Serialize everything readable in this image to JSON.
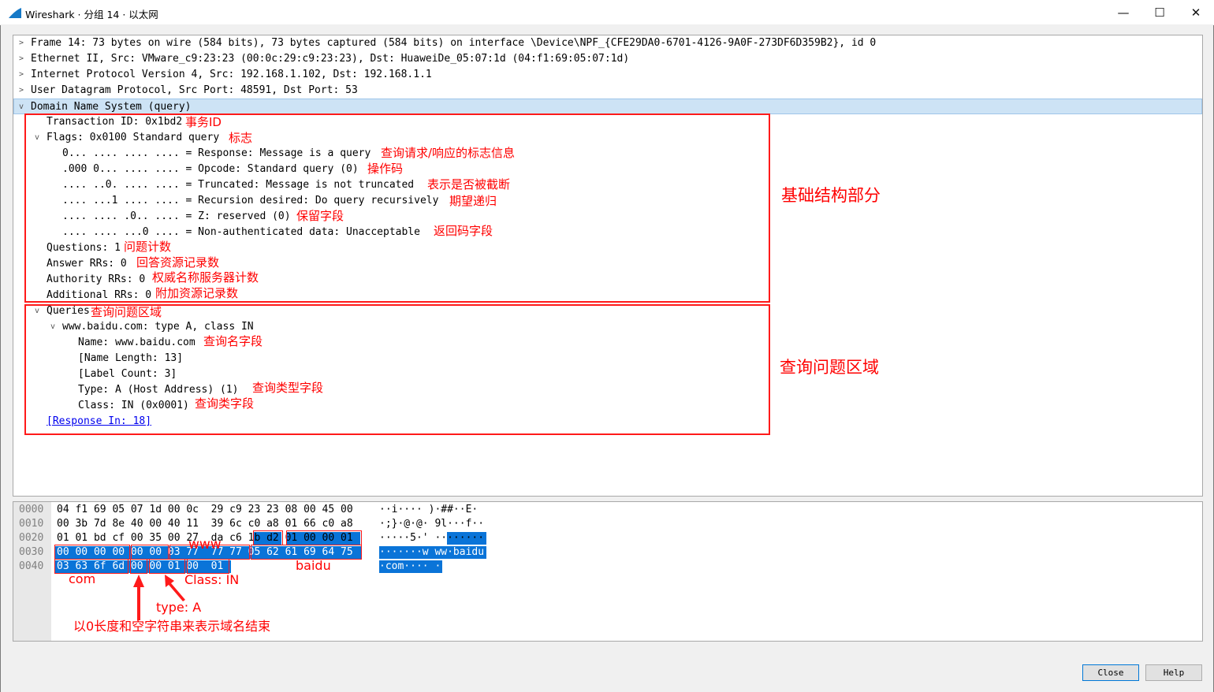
{
  "window": {
    "title": "Wireshark · 分组 14 · 以太网",
    "minimize": "—",
    "maximize": "☐",
    "close": "✕"
  },
  "tree": {
    "rows": [
      {
        "text": "Frame 14: 73 bytes on wire (584 bits), 73 bytes captured (584 bits) on interface \\Device\\NPF_{CFE29DA0-6701-4126-9A0F-273DF6D359B2}, id 0",
        "arrow": ">"
      },
      {
        "text": "Ethernet II, Src: VMware_c9:23:23 (00:0c:29:c9:23:23), Dst: HuaweiDe_05:07:1d (04:f1:69:05:07:1d)",
        "arrow": ">"
      },
      {
        "text": "Internet Protocol Version 4, Src: 192.168.1.102, Dst: 192.168.1.1",
        "arrow": ">"
      },
      {
        "text": "User Datagram Protocol, Src Port: 48591, Dst Port: 53",
        "arrow": ">"
      },
      {
        "text": "Domain Name System (query)",
        "arrow": "v"
      },
      {
        "text": "Transaction ID: 0x1bd2",
        "arrow": ""
      },
      {
        "text": "Flags: 0x0100 Standard query",
        "arrow": "v"
      },
      {
        "text": "0... .... .... .... = Response: Message is a query",
        "arrow": ""
      },
      {
        "text": ".000 0... .... .... = Opcode: Standard query (0)",
        "arrow": ""
      },
      {
        "text": ".... ..0. .... .... = Truncated: Message is not truncated",
        "arrow": ""
      },
      {
        "text": ".... ...1 .... .... = Recursion desired: Do query recursively",
        "arrow": ""
      },
      {
        "text": ".... .... .0.. .... = Z: reserved (0)",
        "arrow": ""
      },
      {
        "text": ".... .... ...0 .... = Non-authenticated data: Unacceptable",
        "arrow": ""
      },
      {
        "text": "Questions: 1",
        "arrow": ""
      },
      {
        "text": "Answer RRs: 0",
        "arrow": ""
      },
      {
        "text": "Authority RRs: 0",
        "arrow": ""
      },
      {
        "text": "Additional RRs: 0",
        "arrow": ""
      },
      {
        "text": "Queries",
        "arrow": "v"
      },
      {
        "text": "www.baidu.com: type A, class IN",
        "arrow": "v"
      },
      {
        "text": "Name: www.baidu.com",
        "arrow": ""
      },
      {
        "text": "[Name Length: 13]",
        "arrow": ""
      },
      {
        "text": "[Label Count: 3]",
        "arrow": ""
      },
      {
        "text": "Type: A (Host Address) (1)",
        "arrow": ""
      },
      {
        "text": "Class: IN (0x0001)",
        "arrow": ""
      },
      {
        "text": "[Response In: 18]",
        "arrow": ""
      }
    ]
  },
  "annotations": {
    "transaction_id": "事务ID",
    "flags": "标志",
    "response": "查询请求/响应的标志信息",
    "opcode": "操作码",
    "truncated": "表示是否被截断",
    "recursion": "期望递归",
    "z": "保留字段",
    "nonauth": "返回码字段",
    "questions": "问题计数",
    "answer": "回答资源记录数",
    "authority": "权威名称服务器计数",
    "additional": "附加资源记录数",
    "queries": "查询问题区域",
    "name": "查询名字段",
    "type": "查询类型字段",
    "class": "查询类字段",
    "section_basic": "基础结构部分",
    "section_query": "查询问题区域",
    "hex_www": "www",
    "hex_baidu": "baidu",
    "hex_com": "com",
    "hex_class": "Class:  IN",
    "hex_type": "type:  A",
    "hex_end": "以0长度和空字符串来表示域名结束"
  },
  "hex": {
    "offsets": [
      "0000",
      "0010",
      "0020",
      "0030",
      "0040"
    ],
    "lines": [
      "04 f1 69 05 07 1d 00 0c  29 c9 23 23 08 00 45 00",
      "00 3b 7d 8e 40 00 40 11  39 6c c0 a8 01 66 c0 a8",
      "01 01 bd cf 00 35 00 27  da c6 1b d2 01 00 00 01",
      "00 00 00 00 00 00 03 77  77 77 05 62 61 69 64 75",
      "03 63 6f 6d 00 00 01 00  01"
    ],
    "ascii": [
      "··i···· )·##··E·",
      "·;}·@·@· 9l···f··",
      "·····5·' ········",
      "·······w ww·baidu",
      "·com···· ·"
    ]
  },
  "buttons": {
    "close": "Close",
    "help": "Help"
  },
  "colors": {
    "highlight": "#0a74d8",
    "annotation": "#ff0000",
    "selection": "#cde3f5"
  }
}
